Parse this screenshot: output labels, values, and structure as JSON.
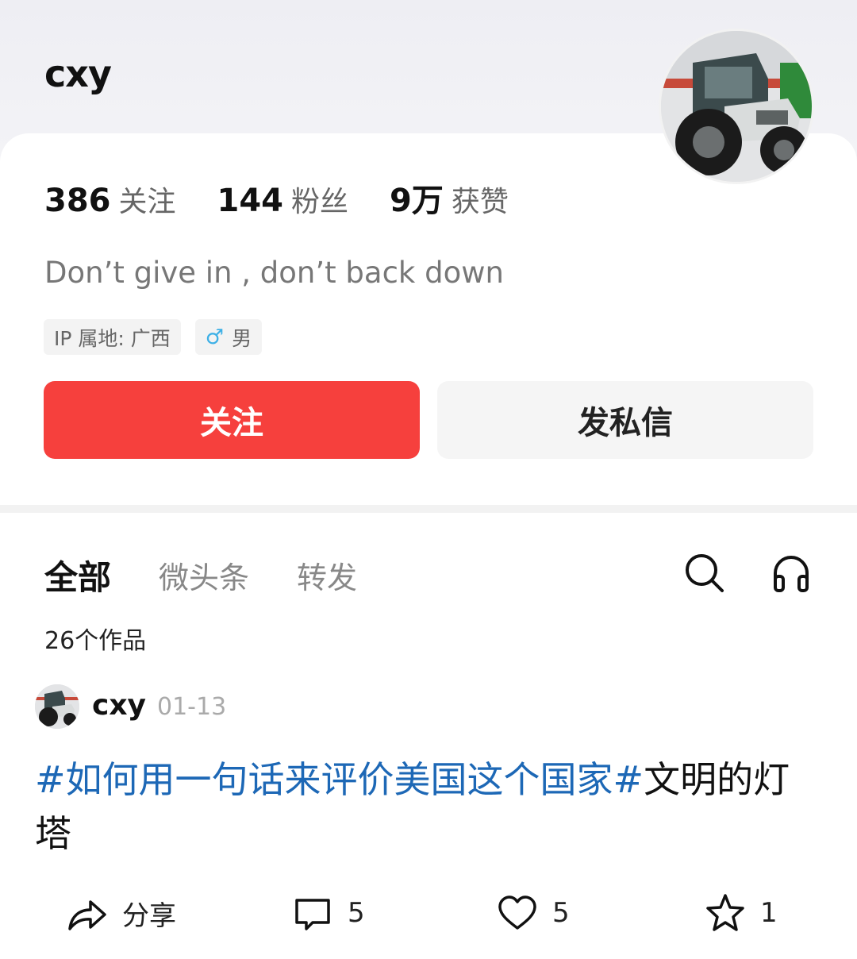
{
  "profile": {
    "name": "cxy",
    "stats": [
      {
        "value": "386",
        "label": "关注"
      },
      {
        "value": "144",
        "label": "粉丝"
      },
      {
        "value": "9万",
        "label": "获赞"
      }
    ],
    "bio": "Don’t give in , don’t back down",
    "tags": {
      "ip": "IP 属地: 广西",
      "gender_icon": "♂",
      "gender": "男"
    },
    "buttons": {
      "follow": "关注",
      "message": "发私信"
    }
  },
  "tabs": [
    "全部",
    "微头条",
    "转发"
  ],
  "works_count": "26个作品",
  "post": {
    "author": "cxy",
    "date": "01-13",
    "hashtag": "#如何用一句话来评价美国这个国家#",
    "text": "文明的灯塔",
    "actions": {
      "share": "分享",
      "comments": "5",
      "likes": "5",
      "favorites": "1"
    }
  },
  "colors": {
    "accent": "#f6403d",
    "hashtag": "#1d68b6",
    "gender_icon": "#3db0e6"
  }
}
